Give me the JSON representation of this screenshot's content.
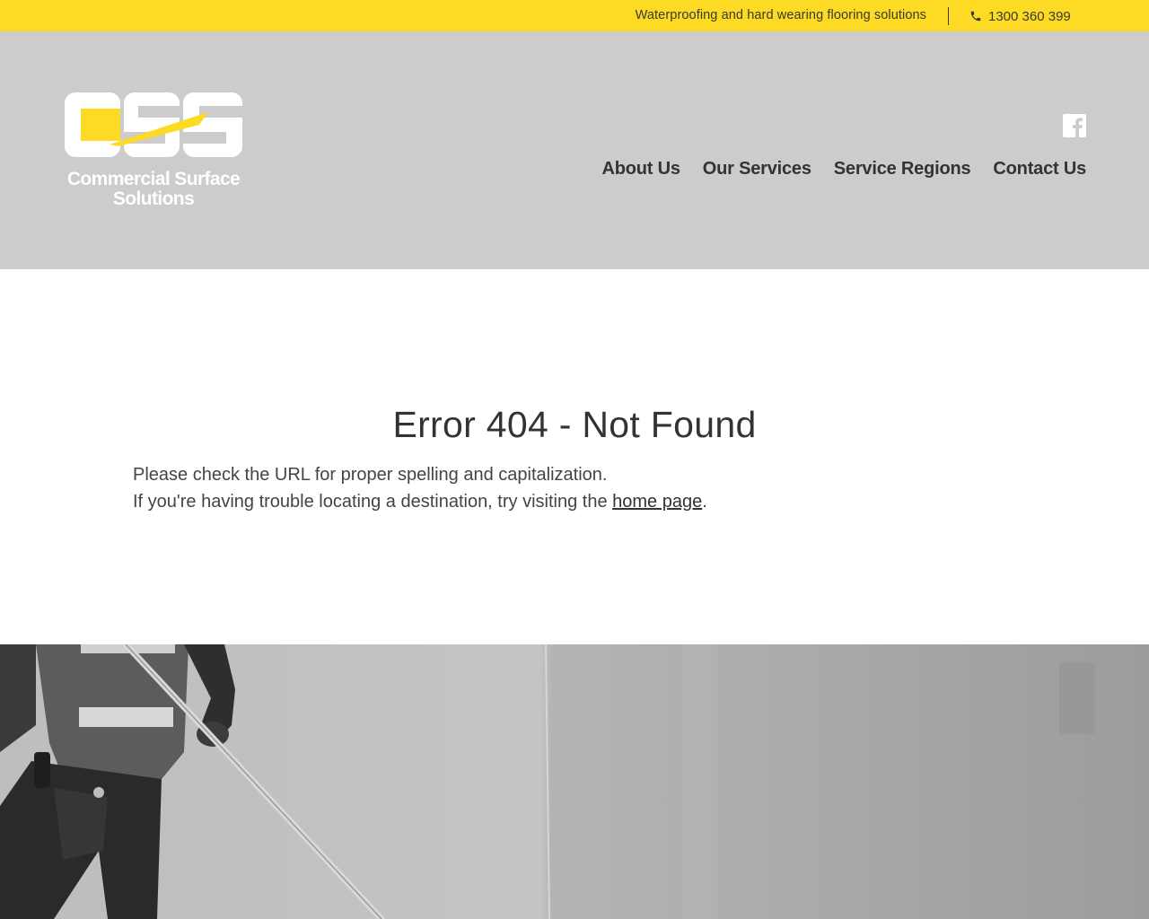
{
  "topbar": {
    "tagline": "Waterproofing and hard wearing flooring solutions",
    "phone_icon": "phone-icon",
    "phone": "1300 360 399"
  },
  "header": {
    "logo": {
      "mark_text": "CSS",
      "line1": "Commercial Surface",
      "line2": "Solutions"
    },
    "social_icon": "facebook-icon",
    "nav": [
      {
        "label": "About Us"
      },
      {
        "label": "Our Services"
      },
      {
        "label": "Service Regions"
      },
      {
        "label": "Contact Us"
      }
    ]
  },
  "main": {
    "title": "Error 404 - Not Found",
    "line1": "Please check the URL for proper spelling and capitalization.",
    "line2_prefix": "If you're having trouble locating a destination, try visiting the ",
    "home_link": "home page",
    "line2_suffix": "."
  },
  "colors": {
    "accent_yellow": "#fdda24",
    "header_grey": "#cccccc",
    "text_dark": "#333333"
  }
}
